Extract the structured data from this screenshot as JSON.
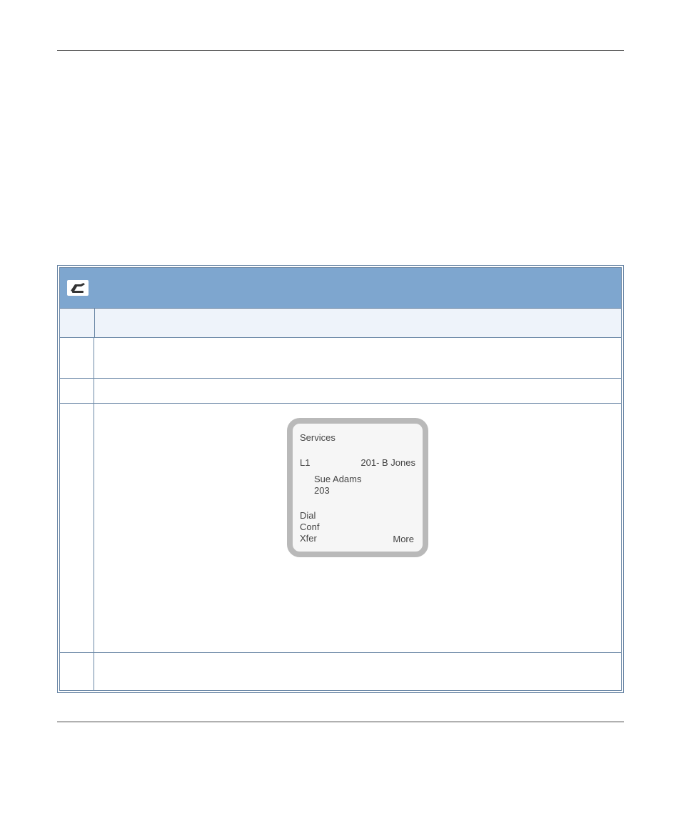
{
  "phone_display": {
    "title": "Services",
    "line_label": "L1",
    "line_info": "201- B Jones",
    "entry_name": "Sue Adams",
    "entry_ext": "203",
    "softkeys_left": [
      "Dial",
      "Conf",
      "Xfer"
    ],
    "softkey_more": "More"
  }
}
